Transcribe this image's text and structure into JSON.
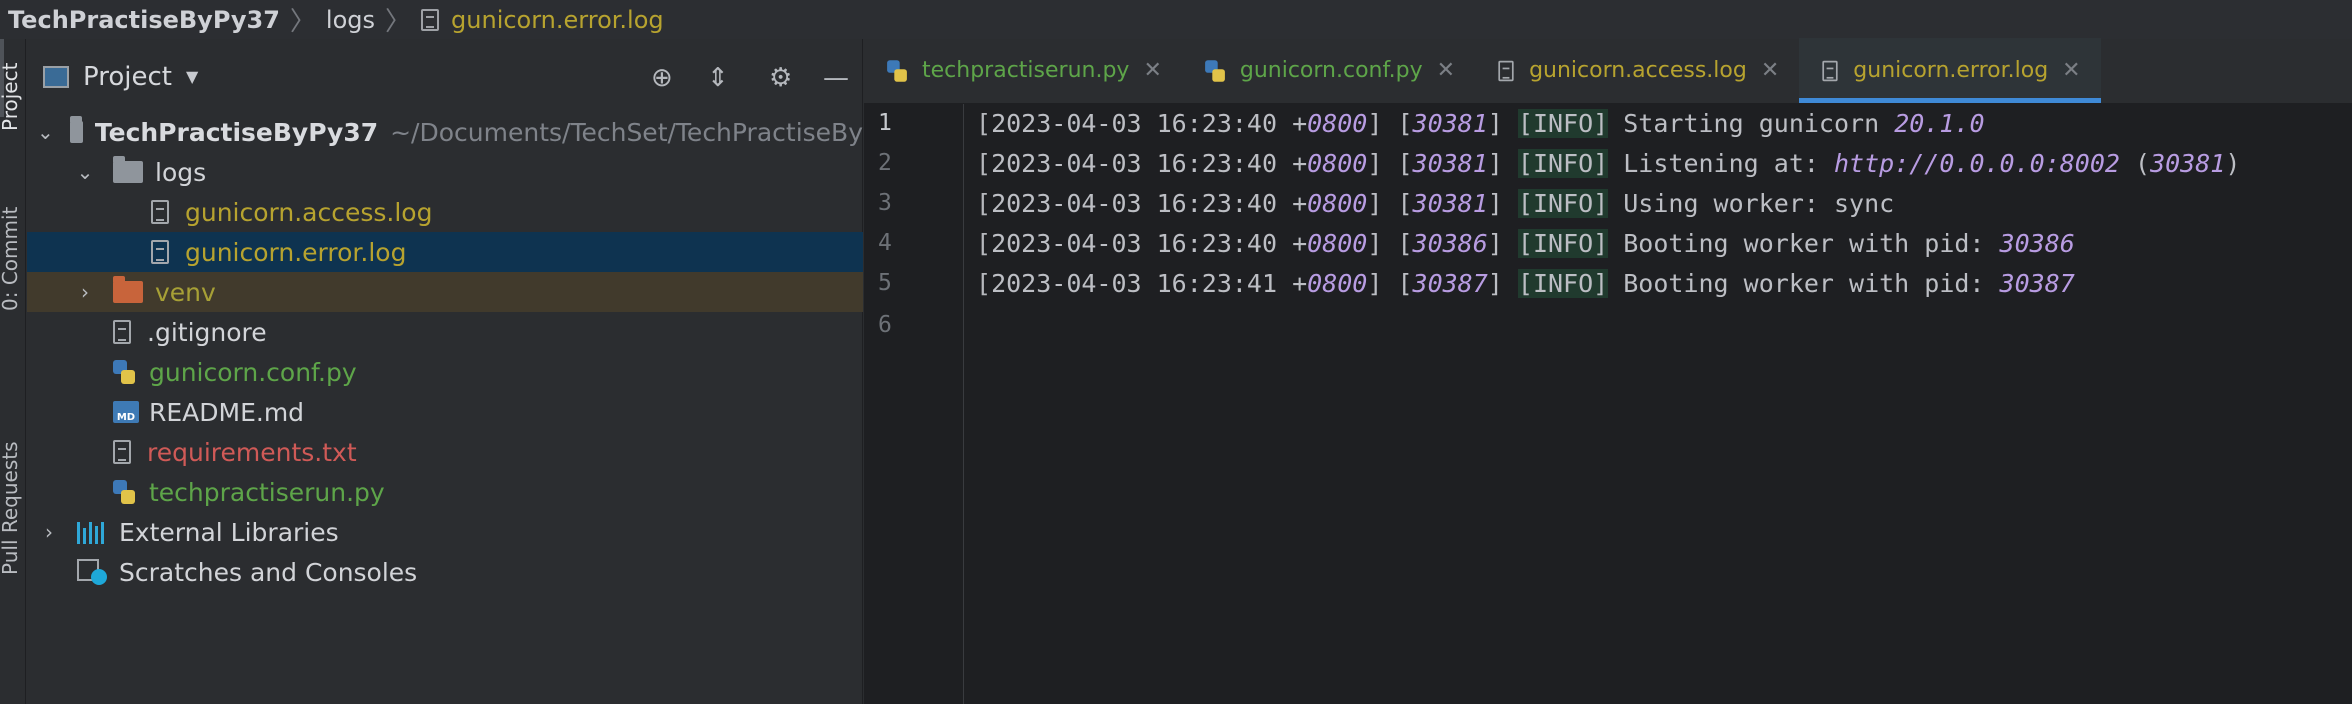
{
  "breadcrumb": {
    "project": "TechPractiseByPy37",
    "folder": "logs",
    "file": "gunicorn.error.log"
  },
  "tool_strip": {
    "tabs": [
      "Project",
      "0: Commit",
      "Pull Requests"
    ]
  },
  "project_panel": {
    "title": "Project",
    "toolbar_icons": [
      "locate-icon",
      "collapse-icon",
      "gear-icon",
      "minimize-icon"
    ],
    "tree": [
      {
        "label": "TechPractiseByPy37",
        "path": "~/Documents/TechSet/TechPractiseBy"
      },
      {
        "label": "logs"
      },
      {
        "label": "gunicorn.access.log"
      },
      {
        "label": "gunicorn.error.log"
      },
      {
        "label": "venv"
      },
      {
        "label": ".gitignore"
      },
      {
        "label": "gunicorn.conf.py"
      },
      {
        "label": "README.md"
      },
      {
        "label": "requirements.txt"
      },
      {
        "label": "techpractiserun.py"
      },
      {
        "label": "External Libraries"
      },
      {
        "label": "Scratches and Consoles"
      }
    ],
    "md_badge": "MD"
  },
  "editor": {
    "tabs": [
      {
        "label": "techpractiserun.py"
      },
      {
        "label": "gunicorn.conf.py"
      },
      {
        "label": "gunicorn.access.log"
      },
      {
        "label": "gunicorn.error.log",
        "active": true
      }
    ],
    "close_glyph": "✕",
    "line_numbers": [
      "1",
      "2",
      "3",
      "4",
      "5",
      "6"
    ],
    "lines": [
      {
        "open": "[",
        "date": "2023-04-03 16:23:40 +",
        "tz": "0800",
        "mid": "] [",
        "pid": "30381",
        "mid2": "] ",
        "level": "[INFO]",
        "msg": " Starting gunicorn ",
        "tail": "20.1.0",
        "post": ""
      },
      {
        "open": "[",
        "date": "2023-04-03 16:23:40 +",
        "tz": "0800",
        "mid": "] [",
        "pid": "30381",
        "mid2": "] ",
        "level": "[INFO]",
        "msg": " Listening at: ",
        "tail": "http://0.0.0.0:8002",
        "post": " (",
        "pid2": "30381",
        "post2": ")"
      },
      {
        "open": "[",
        "date": "2023-04-03 16:23:40 +",
        "tz": "0800",
        "mid": "] [",
        "pid": "30381",
        "mid2": "] ",
        "level": "[INFO]",
        "msg": " Using worker: sync",
        "tail": "",
        "post": ""
      },
      {
        "open": "[",
        "date": "2023-04-03 16:23:40 +",
        "tz": "0800",
        "mid": "] [",
        "pid": "30386",
        "mid2": "] ",
        "level": "[INFO]",
        "msg": " Booting worker with pid: ",
        "tail": "30386",
        "post": ""
      },
      {
        "open": "[",
        "date": "2023-04-03 16:23:41 +",
        "tz": "0800",
        "mid": "] [",
        "pid": "30387",
        "mid2": "] ",
        "level": "[INFO]",
        "msg": " Booting worker with pid: ",
        "tail": "30387",
        "post": ""
      }
    ]
  },
  "colors": {
    "accent": "#3f8ad7",
    "selection": "#0e3350",
    "number": "#b89ce2",
    "info_bg": "#203a2e"
  }
}
